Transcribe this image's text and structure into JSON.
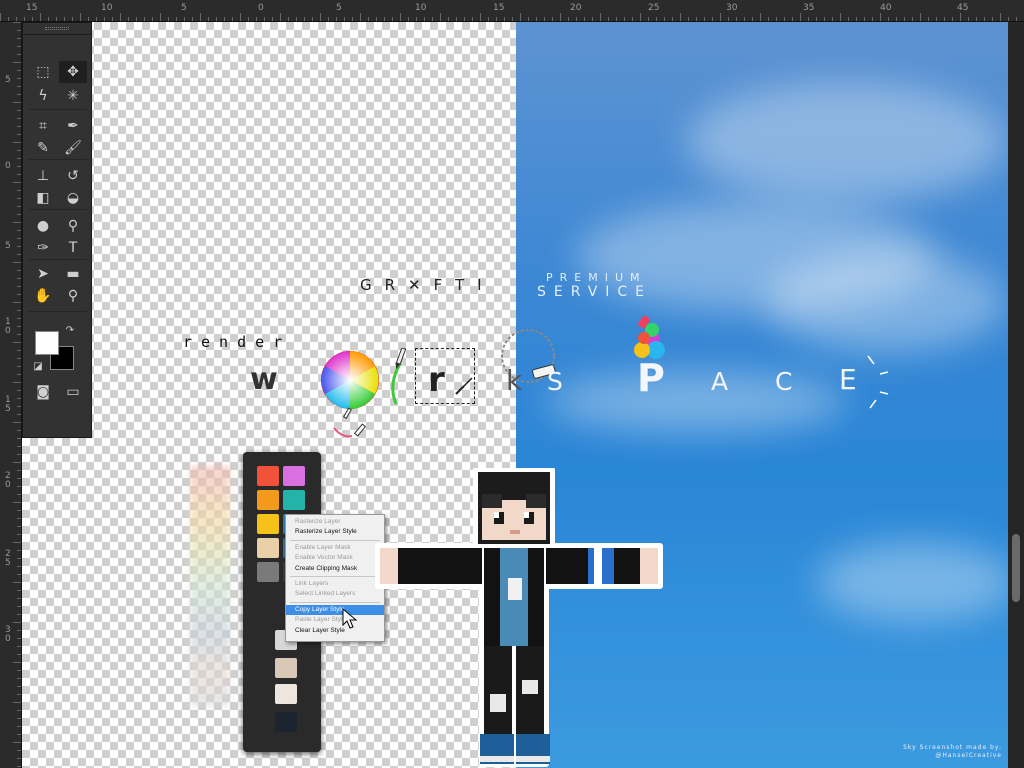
{
  "ruler": {
    "top_labels": [
      "15",
      "10",
      "5",
      "0",
      "5",
      "10",
      "15",
      "20",
      "25",
      "30",
      "35",
      "40",
      "45"
    ],
    "left_labels": [
      "5",
      "0",
      "5",
      "10",
      "15",
      "20",
      "25",
      "30"
    ]
  },
  "toolbox": {
    "tools": [
      {
        "name": "marquee-tool",
        "glyph": "⬚"
      },
      {
        "name": "move-tool",
        "glyph": "✥"
      },
      {
        "name": "lasso-tool",
        "glyph": "ϟ"
      },
      {
        "name": "magic-wand-tool",
        "glyph": "✳"
      },
      {
        "name": "crop-tool",
        "glyph": "⌗"
      },
      {
        "name": "eyedropper-tool",
        "glyph": "✒"
      },
      {
        "name": "healing-tool",
        "glyph": "✎"
      },
      {
        "name": "brush-tool",
        "glyph": "🖌"
      },
      {
        "name": "stamp-tool",
        "glyph": "⊥"
      },
      {
        "name": "history-brush-tool",
        "glyph": "↺"
      },
      {
        "name": "eraser-tool",
        "glyph": "◧"
      },
      {
        "name": "paint-bucket-tool",
        "glyph": "◒"
      },
      {
        "name": "blur-tool",
        "glyph": "●"
      },
      {
        "name": "dodge-tool",
        "glyph": "⚲"
      },
      {
        "name": "pen-tool",
        "glyph": "✑"
      },
      {
        "name": "type-tool",
        "glyph": "T"
      },
      {
        "name": "path-select-tool",
        "glyph": "➤"
      },
      {
        "name": "shape-tool",
        "glyph": "▬"
      },
      {
        "name": "hand-tool",
        "glyph": "✋"
      },
      {
        "name": "zoom-tool",
        "glyph": "⚲"
      }
    ],
    "foreground_color": "#ffffff",
    "background_color": "#000000"
  },
  "artwork": {
    "brand_text": "GR✕FTI",
    "premium_text": "PREMIUM",
    "service_text": "SERVICE",
    "render_text": "render",
    "letter_w": "w",
    "letter_r": "r",
    "letter_k": "k",
    "letter_s": "S",
    "letter_p": "P",
    "letter_a": "A",
    "letter_c": "C",
    "letter_e": "E",
    "credit_line1": "Sky Screenshot made by:",
    "credit_line2": "@HanselCreative"
  },
  "context_menu": {
    "items": [
      {
        "label": "Rasterize Layer",
        "disabled": true
      },
      {
        "label": "Rasterize Layer Style",
        "disabled": false
      },
      {
        "sep": true
      },
      {
        "label": "Enable Layer Mask",
        "disabled": true
      },
      {
        "label": "Enable Vector Mask",
        "disabled": true
      },
      {
        "label": "Create Clipping Mask",
        "disabled": false
      },
      {
        "sep": true
      },
      {
        "label": "Link Layers",
        "disabled": true
      },
      {
        "label": "Select Linked Layers",
        "disabled": true
      },
      {
        "sep": true
      },
      {
        "label": "Copy Layer Style",
        "disabled": false,
        "highlighted": true
      },
      {
        "label": "Paste Layer Style",
        "disabled": true
      },
      {
        "label": "Clear Layer Style",
        "disabled": false
      }
    ]
  },
  "swatches": {
    "colors": [
      "#f0523a",
      "#d96fe0",
      "#f39a1c",
      "#23b3a8",
      "#f6c21a",
      "#2a7fb0",
      "#e9d0a8",
      "#3a6f9a",
      "#7a7a7a",
      "#3a3a3a",
      "#d8d8d8",
      "#d9c7b8",
      "#ece6df",
      "#1c2430"
    ]
  }
}
